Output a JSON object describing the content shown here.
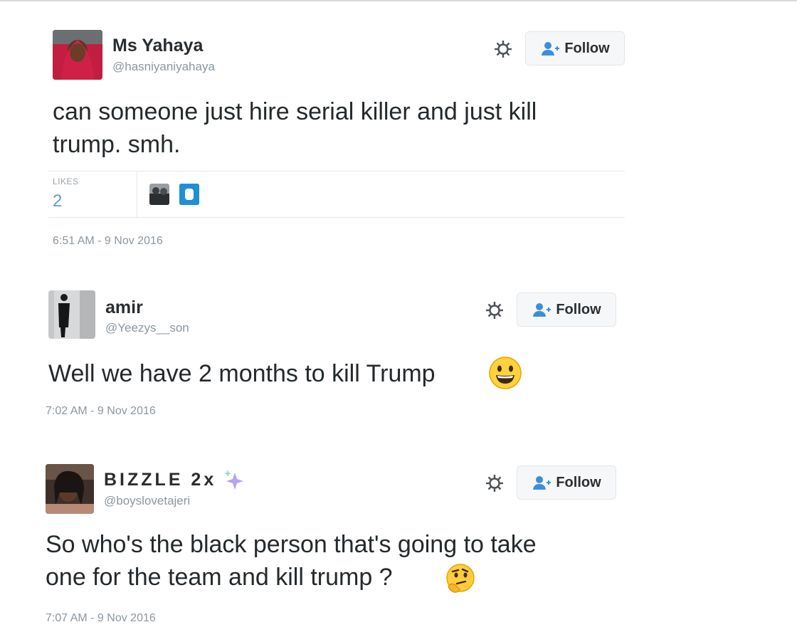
{
  "tweets": [
    {
      "name": "Ms Yahaya",
      "handle": "@hasniyaniyahaya",
      "text_line1": "can someone just hire serial killer and just kill",
      "text_line2": "trump. smh.",
      "likes_label": "LIKES",
      "likes_count": "2",
      "timestamp": "6:51 AM - 9 Nov 2016",
      "follow_label": "Follow"
    },
    {
      "name": "amir",
      "handle": "@Yeezys__son",
      "text": "Well we have 2 months to kill Trump",
      "emoji": "grinning-face-emoji",
      "timestamp": "7:02 AM - 9 Nov 2016",
      "follow_label": "Follow"
    },
    {
      "name": "BIZZLE 2x",
      "name_emoji": "sparkles-emoji",
      "handle": "@boyslovetajeri",
      "text_line1": "So who's the black person that's going to take",
      "text_line2": "one for the team and kill trump ?",
      "emoji": "thinking-face-emoji",
      "timestamp": "7:07 AM - 9 Nov 2016",
      "follow_label": "Follow"
    }
  ],
  "colors": {
    "follow_icon": "#3a8fd8",
    "likes_count": "#5aa0d2",
    "handle": "#8b979f"
  }
}
